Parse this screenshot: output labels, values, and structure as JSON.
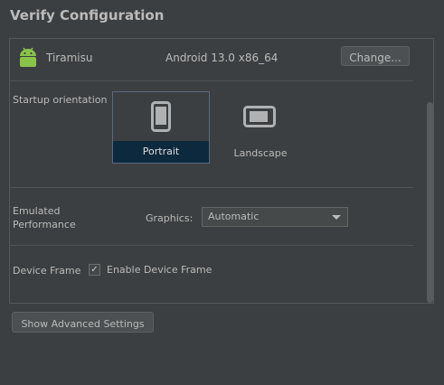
{
  "dialog": {
    "title": "Verify Configuration"
  },
  "system_image": {
    "icon": "android-icon",
    "name": "Tiramisu",
    "description": "Android 13.0 x86_64",
    "change_label": "Change..."
  },
  "startup_orientation": {
    "label": "Startup orientation",
    "options": [
      {
        "label": "Portrait",
        "icon": "portrait-phone-icon",
        "selected": true
      },
      {
        "label": "Landscape",
        "icon": "landscape-phone-icon",
        "selected": false
      }
    ]
  },
  "emulated_performance": {
    "label_line1": "Emulated",
    "label_line2": "Performance",
    "graphics_label": "Graphics:",
    "graphics_value": "Automatic"
  },
  "device_frame": {
    "label": "Device Frame",
    "checkbox_label": "Enable Device Frame",
    "checked": true
  },
  "footer": {
    "advanced_label": "Show Advanced Settings"
  },
  "colors": {
    "background": "#3c3f41",
    "selection": "#0d293e",
    "android_green": "#8bc34a"
  }
}
